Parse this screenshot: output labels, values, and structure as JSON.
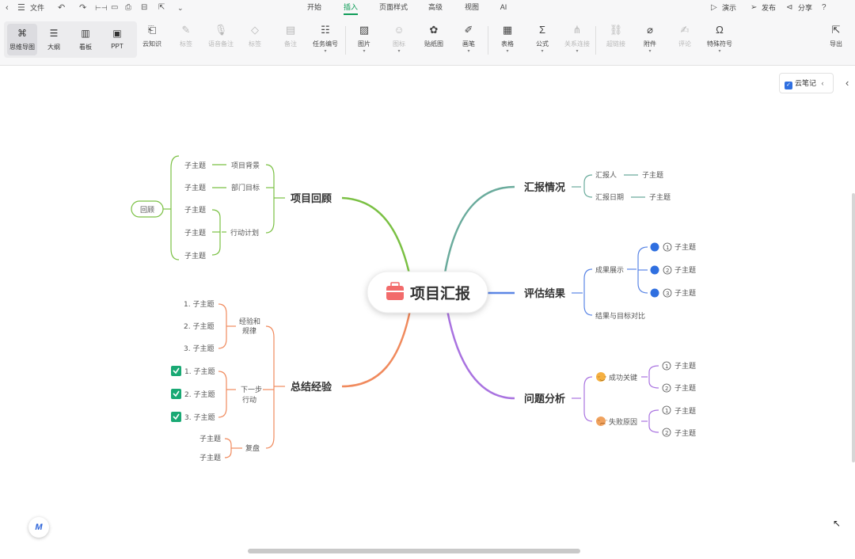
{
  "menubar": {
    "back": "‹",
    "menu_icon": "☰",
    "file": "文件",
    "undo": "↶",
    "redo": "↷",
    "tabs": [
      "开始",
      "插入",
      "页面样式",
      "高级",
      "视图",
      "AI"
    ],
    "active_tab": "插入",
    "right": {
      "present": "演示",
      "publish": "发布",
      "share": "分享",
      "help": "?"
    }
  },
  "ribbon": {
    "views": [
      "思维导图",
      "大纲",
      "看板",
      "PPT"
    ],
    "selected_view": "思维导图",
    "buttons": [
      {
        "id": "cloud",
        "label": "云知识",
        "icon": "cloud-doc-icon",
        "disabled": false,
        "caret": false
      },
      {
        "id": "label",
        "label": "标签",
        "icon": "tag-pen-icon",
        "disabled": true,
        "caret": false
      },
      {
        "id": "voice",
        "label": "语音备注",
        "icon": "mic-icon",
        "disabled": true,
        "caret": false
      },
      {
        "id": "tag",
        "label": "标签",
        "icon": "tag-icon",
        "disabled": true,
        "caret": false
      },
      {
        "id": "note",
        "label": "备注",
        "icon": "note-icon",
        "disabled": true,
        "caret": false
      },
      {
        "id": "tasklist",
        "label": "任务编号",
        "icon": "list-number-icon",
        "disabled": false,
        "caret": true
      },
      {
        "id": "image",
        "label": "图片",
        "icon": "image-icon",
        "disabled": false,
        "caret": true
      },
      {
        "id": "icon",
        "label": "图标",
        "icon": "smiley-icon",
        "disabled": true,
        "caret": true
      },
      {
        "id": "sticker",
        "label": "贴纸图",
        "icon": "sticker-icon",
        "disabled": false,
        "caret": false
      },
      {
        "id": "draw",
        "label": "画笔",
        "icon": "pen-icon",
        "disabled": false,
        "caret": true
      },
      {
        "id": "table",
        "label": "表格",
        "icon": "table-icon",
        "disabled": false,
        "caret": true
      },
      {
        "id": "formula",
        "label": "公式",
        "icon": "sigma-icon",
        "disabled": false,
        "caret": true
      },
      {
        "id": "relation",
        "label": "关系连接",
        "icon": "connect-icon",
        "disabled": true,
        "caret": true
      },
      {
        "id": "link",
        "label": "超链接",
        "icon": "link-icon",
        "disabled": true,
        "caret": false
      },
      {
        "id": "attach",
        "label": "附件",
        "icon": "paperclip-icon",
        "disabled": false,
        "caret": true
      },
      {
        "id": "comment",
        "label": "评论",
        "icon": "comment-icon",
        "disabled": true,
        "caret": false
      },
      {
        "id": "symbol",
        "label": "特殊符号",
        "icon": "omega-icon",
        "disabled": false,
        "caret": true
      }
    ],
    "export": "导出"
  },
  "canvas": {
    "notes_button": "云笔记",
    "center": "项目汇报",
    "branches": {
      "review": {
        "title": "项目回顾",
        "color": "#7ac043",
        "groups": [
          {
            "label": "项目背景",
            "children": [
              "子主题"
            ]
          },
          {
            "label": "部门目标",
            "children": [
              "子主题"
            ]
          },
          {
            "label": "行动计划",
            "children": [
              "子主题",
              "子主题",
              "子主题"
            ]
          }
        ],
        "outer": "回顾"
      },
      "report": {
        "title": "汇报情况",
        "color": "#6aab9c",
        "items": [
          {
            "label": "汇报人",
            "child": "子主题"
          },
          {
            "label": "汇报日期",
            "child": "子主题"
          }
        ]
      },
      "eval": {
        "title": "评估结果",
        "color": "#5b86e5",
        "items": [
          {
            "label": "成果展示",
            "children": [
              "子主题",
              "子主题",
              "子主题"
            ]
          },
          {
            "label": "结果与目标对比",
            "children": []
          }
        ]
      },
      "problem": {
        "title": "问题分析",
        "color": "#a973e0",
        "items": [
          {
            "label": "成功关键",
            "children": [
              "子主题",
              "子主题"
            ]
          },
          {
            "label": "失败原因",
            "children": [
              "子主题",
              "子主题"
            ]
          }
        ]
      },
      "summary": {
        "title": "总结经验",
        "color": "#f08a5d",
        "groups": [
          {
            "label": "经验和规律",
            "children": [
              "1. 子主题",
              "2. 子主题",
              "3. 子主题"
            ]
          },
          {
            "label": "下一步行动",
            "children": [
              "1. 子主题",
              "2. 子主题",
              "3. 子主题"
            ]
          },
          {
            "label": "复盘",
            "children": [
              "子主题",
              "子主题"
            ]
          }
        ]
      }
    }
  }
}
